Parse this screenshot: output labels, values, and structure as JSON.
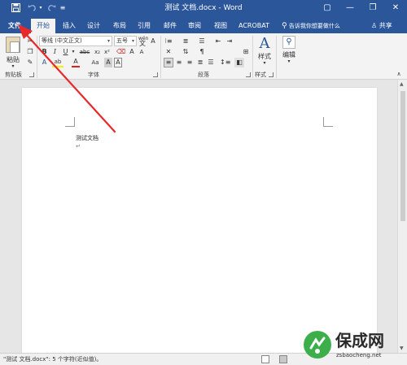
{
  "titlebar": {
    "title": "测试 文档.docx - Word",
    "save_icon": "save-icon",
    "undo_icon": "undo-icon",
    "redo_icon": "redo-icon",
    "minimize_glyph": "—",
    "restore_glyph": "❐",
    "close_glyph": "✕",
    "ribbon_options_glyph": "▢"
  },
  "tabs": [
    {
      "label": "文件"
    },
    {
      "label": "开始"
    },
    {
      "label": "插入"
    },
    {
      "label": "设计"
    },
    {
      "label": "布局"
    },
    {
      "label": "引用"
    },
    {
      "label": "邮件"
    },
    {
      "label": "审阅"
    },
    {
      "label": "视图"
    },
    {
      "label": "ACROBAT"
    }
  ],
  "tell_me": "告诉我你想要做什么",
  "share": "共享",
  "ribbon": {
    "clipboard": {
      "paste_label": "粘贴",
      "group_label": "剪贴板"
    },
    "font": {
      "font_name": "等线 (中文正文)",
      "font_size": "五号",
      "size_up": "A",
      "size_down": "A",
      "clear": "A",
      "wen": "wén",
      "bold": "B",
      "italic": "I",
      "underline": "U",
      "strike": "abc",
      "sub": "x₂",
      "sup": "x²",
      "text_effects": "A",
      "highlight": "ab",
      "font_color": "A",
      "case": "Aa",
      "char_shade": "A",
      "char_border": "A",
      "group_label": "字体"
    },
    "paragraph": {
      "group_label": "段落"
    },
    "styles": {
      "label": "样式",
      "group_label": "样式"
    },
    "editing": {
      "label": "编辑"
    },
    "collapse_glyph": "∧"
  },
  "document": {
    "text": "测试文档",
    "paragraph_mark": "↵"
  },
  "status": {
    "text": "\"测试 文档.docx\": 5 个字符(近似值)。"
  },
  "watermark": {
    "name": "保成网",
    "url": "zsbaocheng.net"
  },
  "colors": {
    "title_blue": "#2b579a",
    "arrow_red": "#e8282b",
    "font_color_red": "#e02020",
    "highlight_yellow": "#ffee00",
    "watermark_green": "#3cae4a"
  }
}
